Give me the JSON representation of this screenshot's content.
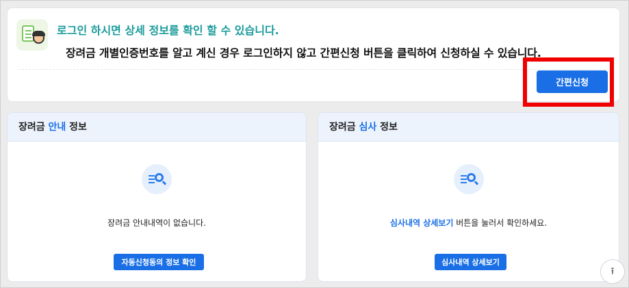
{
  "notice": {
    "title": "로그인 하시면 상세 정보를 확인 할 수 있습니다.",
    "description": "장려금 개별인증번호를 알고 계신 경우 로그인하지 않고 간편신청 버튼을 클릭하여 신청하실 수 있습니다.",
    "simple_apply_label": "간편신청"
  },
  "guide_panel": {
    "title_prefix": "장려금 ",
    "title_accent": "안내",
    "title_suffix": " 정보",
    "empty_message": "장려금 안내내역이 없습니다.",
    "button_label": "자동신청동의 정보 확인"
  },
  "review_panel": {
    "title_prefix": "장려금 ",
    "title_accent": "심사",
    "title_suffix": " 정보",
    "message_accent": "심사내역 상세보기",
    "message_rest": " 버튼을 눌러서 확인하세요.",
    "button_label": "심사내역 상세보기"
  },
  "scroll_top": {
    "icon": "arrow-up-icon",
    "glyph": "⭱"
  },
  "colors": {
    "accent_blue": "#1a6fe6",
    "title_teal": "#1a9b9b",
    "highlight_red": "#f00000"
  }
}
